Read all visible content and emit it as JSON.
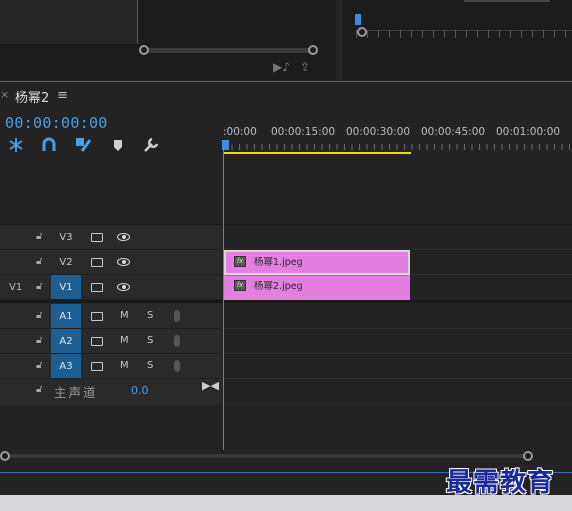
{
  "sequence": {
    "tab_title": "杨幂2",
    "tab_close": "×",
    "tab_menu": "≡",
    "timecode": "00:00:00:00"
  },
  "tools": [
    "snap-icon",
    "magnet-icon",
    "linked-select-icon",
    "marker-icon",
    "wrench-icon"
  ],
  "ruler": {
    "ticks": [
      ":00:00",
      "00:00:15:00",
      "00:00:30:00",
      "00:00:45:00",
      "00:01:00:00"
    ]
  },
  "tracks": {
    "video": [
      {
        "name": "V3",
        "active": false,
        "source": ""
      },
      {
        "name": "V2",
        "active": false,
        "source": ""
      },
      {
        "name": "V1",
        "active": true,
        "source": "V1"
      }
    ],
    "audio": [
      {
        "name": "A1",
        "mute": "M",
        "solo": "S"
      },
      {
        "name": "A2",
        "mute": "M",
        "solo": "S"
      },
      {
        "name": "A3",
        "mute": "M",
        "solo": "S"
      }
    ],
    "master": {
      "label": "主声道",
      "value": "0.0"
    }
  },
  "clips": [
    {
      "track": "V2",
      "name": "杨幂1.jpeg",
      "fx": "fx"
    },
    {
      "track": "V1",
      "name": "杨幂2.jpeg",
      "fx": "fx"
    }
  ],
  "colors": {
    "accent": "#3a8ee6",
    "clip": "#e37fe0",
    "work_area": "#e8e000",
    "track_active": "#1e5f93"
  },
  "watermark": "最需教育"
}
